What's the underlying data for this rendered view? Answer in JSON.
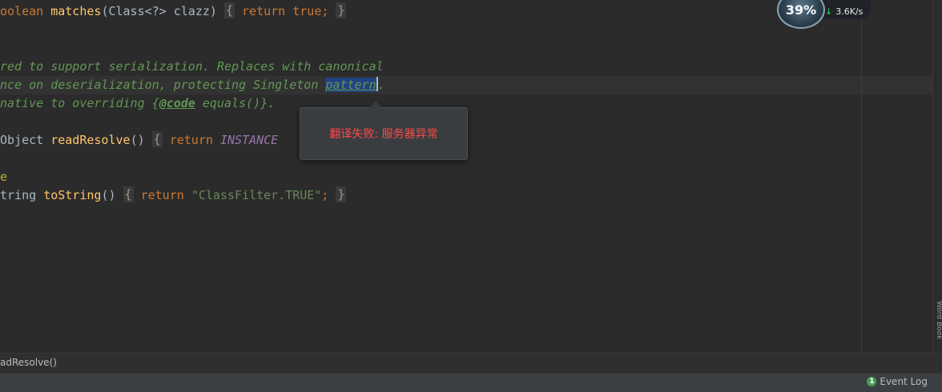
{
  "editor": {
    "lines": {
      "l1": {
        "kw": "oolean",
        "fn": "matches",
        "sig": "(Class<?> clazz)",
        "fold_open": "{",
        "body": " return true; ",
        "fold_close": "}"
      },
      "l2": {
        "doc": "red to support serialization. Replaces with canonical"
      },
      "l3": {
        "doc_a": "nce on deserialization, protecting Singleton ",
        "sel": "pattern",
        "doc_b": "."
      },
      "l4": {
        "doc_a": "native to overriding {",
        "tag": "@code",
        "doc_b": " equals()}."
      },
      "l5": {
        "type": "Object ",
        "fn": "readResolve",
        "sig": "()",
        "fold_open": "{",
        "kw": " return ",
        "const": "INSTANCE"
      },
      "l6": {
        "ann": "e"
      },
      "l7": {
        "type": "tring ",
        "fn": "toString",
        "sig": "()",
        "fold_open": "{",
        "kw": " return ",
        "str": "\"ClassFilter.TRUE\"",
        "semi": ";",
        "fold_close": "}"
      }
    }
  },
  "popup": {
    "message": "翻译失败: 服务器异常"
  },
  "widget": {
    "percent": "39%",
    "speed": "3.6K/s"
  },
  "right_strip": {
    "tool": "Word Book"
  },
  "breadcrumb": {
    "text": "adResolve()"
  },
  "status": {
    "event_badge": "1",
    "event_log": "Event Log"
  },
  "colors": {
    "background": "#2b2b2b",
    "keyword": "#cc7832",
    "function": "#ffc66d",
    "doc": "#629755",
    "error": "#ff4a4a"
  }
}
